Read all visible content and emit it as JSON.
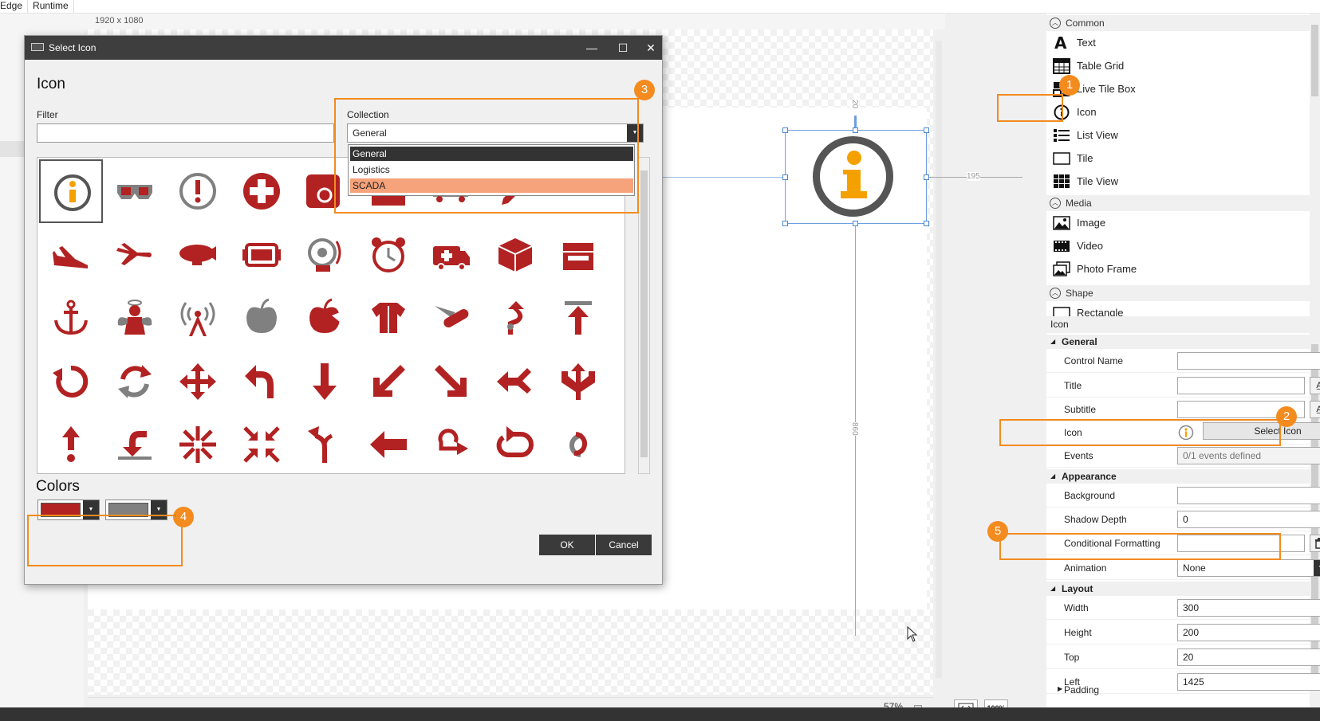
{
  "menubar": {
    "items": [
      "Edge",
      "Runtime"
    ]
  },
  "canvas": {
    "resolution": "1920 x 1080",
    "dim_top": "20",
    "dim_right": "195",
    "dim_bottom": "860"
  },
  "zoom": {
    "level": "57%",
    "fit_icon": "fit-width-icon",
    "actual_label": "100%"
  },
  "toolbox": {
    "sections": [
      {
        "label": "Common",
        "items": [
          {
            "label": "Text",
            "icon": "text-icon"
          },
          {
            "label": "Table Grid",
            "icon": "table-grid-icon"
          },
          {
            "label": "Live Tile Box",
            "icon": "live-tile-icon"
          },
          {
            "label": "Icon",
            "icon": "info-icon"
          },
          {
            "label": "List View",
            "icon": "list-view-icon"
          },
          {
            "label": "Tile",
            "icon": "tile-icon"
          },
          {
            "label": "Tile View",
            "icon": "tile-view-icon"
          }
        ]
      },
      {
        "label": "Media",
        "items": [
          {
            "label": "Image",
            "icon": "image-icon"
          },
          {
            "label": "Video",
            "icon": "video-icon"
          },
          {
            "label": "Photo Frame",
            "icon": "photo-frame-icon"
          }
        ]
      },
      {
        "label": "Shape",
        "items": [
          {
            "label": "Rectangle",
            "icon": "rectangle-icon"
          }
        ]
      }
    ]
  },
  "properties": {
    "title": "Icon",
    "general": {
      "label": "General",
      "control_name": {
        "label": "Control Name",
        "value": ""
      },
      "title": {
        "label": "Title",
        "value": ""
      },
      "subtitle": {
        "label": "Subtitle",
        "value": ""
      },
      "icon": {
        "label": "Icon",
        "button": "Select Icon"
      },
      "events": {
        "label": "Events",
        "value": "0/1 events defined",
        "btn": "<>"
      }
    },
    "appearance": {
      "label": "Appearance",
      "background": {
        "label": "Background",
        "value": ""
      },
      "shadow_depth": {
        "label": "Shadow Depth",
        "value": "0"
      },
      "conditional_formatting": {
        "label": "Conditional Formatting",
        "value": ""
      },
      "animation": {
        "label": "Animation",
        "value": "None"
      }
    },
    "layout": {
      "label": "Layout",
      "width": {
        "label": "Width",
        "value": "300"
      },
      "height": {
        "label": "Height",
        "value": "200"
      },
      "top": {
        "label": "Top",
        "value": "20"
      },
      "left": {
        "label": "Left",
        "value": "1425"
      },
      "padding": {
        "label": "Padding"
      }
    }
  },
  "dialog": {
    "window_title": "Select Icon",
    "heading": "Icon",
    "filter": {
      "label": "Filter",
      "value": ""
    },
    "collection": {
      "label": "Collection",
      "selected": "General",
      "options": [
        "General",
        "Logistics",
        "SCADA"
      ]
    },
    "icons": [
      "info-icon",
      "3d-glasses-icon",
      "exclamation-icon",
      "first-aid-icon",
      "mail-icon",
      "briefcase-icon",
      "truck-icon",
      "pen-icon",
      "lamp-icon",
      "airplane-landing-icon",
      "airplane-icon",
      "airship-icon",
      "battery-icon",
      "alarm-bell-icon",
      "alarm-clock-icon",
      "ambulance-icon",
      "box-icon",
      "boxes-icon",
      "anchor-icon",
      "angel-icon",
      "antenna-icon",
      "apple-gray-icon",
      "apple-icon",
      "armor-icon",
      "army-knife-icon",
      "arrow-turn-up-icon",
      "arrow-up-bar-icon",
      "rotate-left-icon",
      "sync-icon",
      "move-icon",
      "arrow-back-icon",
      "arrow-down-icon",
      "arrow-down-left-icon",
      "arrow-down-right-icon",
      "arrow-merge-icon",
      "arrow-split-icon",
      "arrow-up-dot-icon",
      "arrow-return-icon",
      "arrows-inward-icon",
      "arrows-collapse-icon",
      "arrow-fork-icon",
      "arrow-left-icon",
      "arrow-roundtrip-icon",
      "arrow-loop-icon",
      "arrow-cycle-icon"
    ],
    "colors": {
      "label": "Colors",
      "primary": "#b22222",
      "secondary": "#808080"
    },
    "ok_label": "OK",
    "cancel_label": "Cancel"
  },
  "callouts": [
    "1",
    "2",
    "3",
    "4",
    "5"
  ],
  "colors": {
    "accent": "#f38b1f",
    "icon_red": "#b22222",
    "icon_gray": "#808080",
    "info_orange": "#f4a100",
    "dark": "#3e3e3e"
  }
}
